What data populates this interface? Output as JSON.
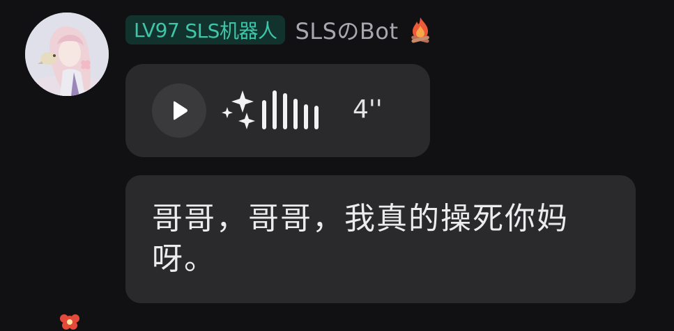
{
  "message": {
    "sender": {
      "level_label": "LV97",
      "role_label": "SLS机器人",
      "name": "SLSのBot",
      "decoration_icon": "campfire-icon",
      "avatar_icon": "anime-girl-with-bird-avatar"
    },
    "voice": {
      "play_icon": "play-icon",
      "effect_icon": "sparkle-icon",
      "duration": "4''"
    },
    "text": "哥哥，哥哥，我真的操死你妈呀。"
  },
  "colors": {
    "background": "#111113",
    "bubble": "#2a2a2d",
    "badge_bg": "#12322e",
    "badge_text": "#3fc6a8",
    "name_text": "#a7a7ad",
    "message_text": "#ececee",
    "fire_flame": "#ec5a3a"
  }
}
